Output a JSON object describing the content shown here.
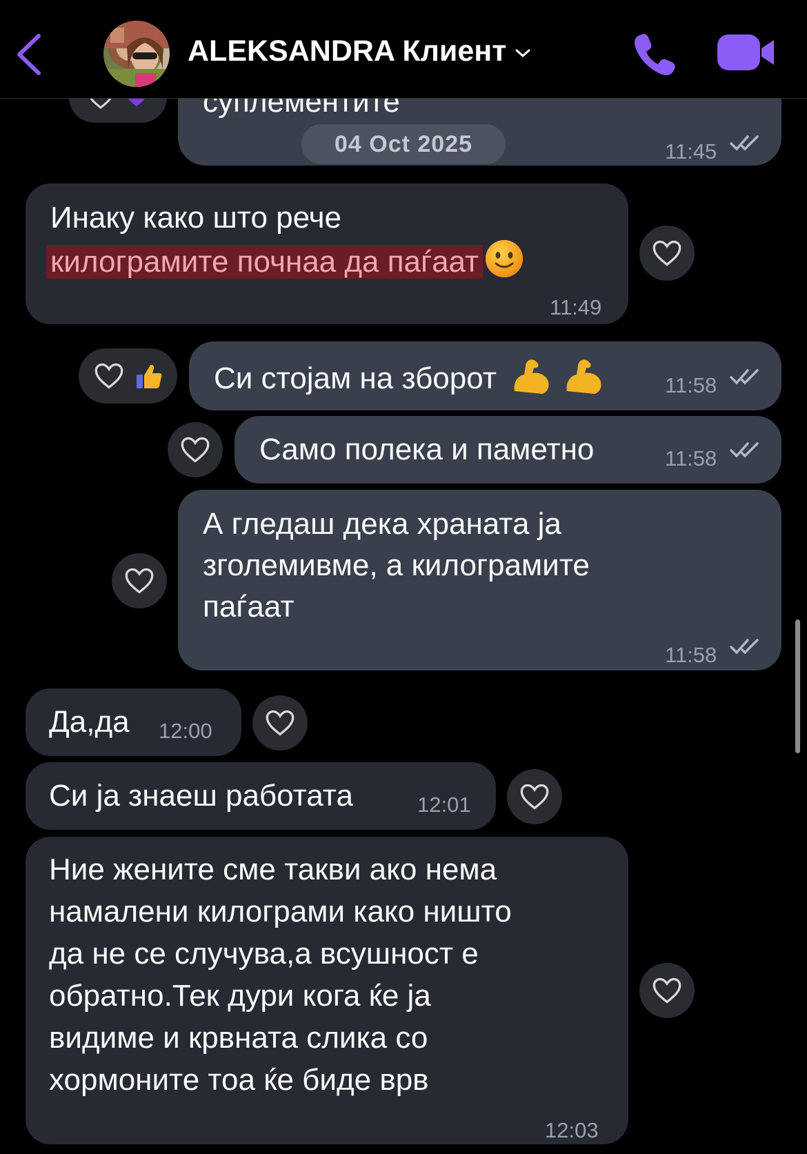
{
  "header": {
    "contact_name": "ALEKSANDRA Клиент",
    "icons": [
      "back-chevron-icon",
      "avatar",
      "chevron-down-icon",
      "phone-icon",
      "video-camera-icon"
    ],
    "accent_color": "#8b5cf6"
  },
  "date_separator": "04 Oct 2025",
  "messages": [
    {
      "dir": "out",
      "text": "суплементите",
      "time": "11:45",
      "read": true
    },
    {
      "dir": "in",
      "line1": "Инаку како што рече",
      "highlight": "килограмите почнаа да паѓаат",
      "emoji": "slightly-smiling-face",
      "time": "11:49"
    },
    {
      "dir": "out",
      "text": "Си стојам на зборот",
      "emoji": "flexed-biceps x2",
      "time": "11:58",
      "reactions": [
        "heart-icon",
        "thumbs-up"
      ]
    },
    {
      "dir": "out",
      "text": "Само полека и паметно",
      "time": "11:58"
    },
    {
      "dir": "out",
      "lines": [
        "А гледаш дека храната ја",
        "зголемивме, а килограмите",
        "паѓаат"
      ],
      "time": "11:58"
    },
    {
      "dir": "in",
      "text": "Да,да",
      "time": "12:00"
    },
    {
      "dir": "in",
      "text": "Си ја знаеш работата",
      "time": "12:01"
    },
    {
      "dir": "in",
      "lines": [
        "Ние жените сме такви ако нема",
        "намалени килограми како ништо",
        "да не се случува,а всушност е",
        "обратно.Тек дури кога ќе ја",
        "видиме и крвната слика со",
        "хормоните тоа ќе биде врв"
      ],
      "time": "12:03"
    }
  ]
}
